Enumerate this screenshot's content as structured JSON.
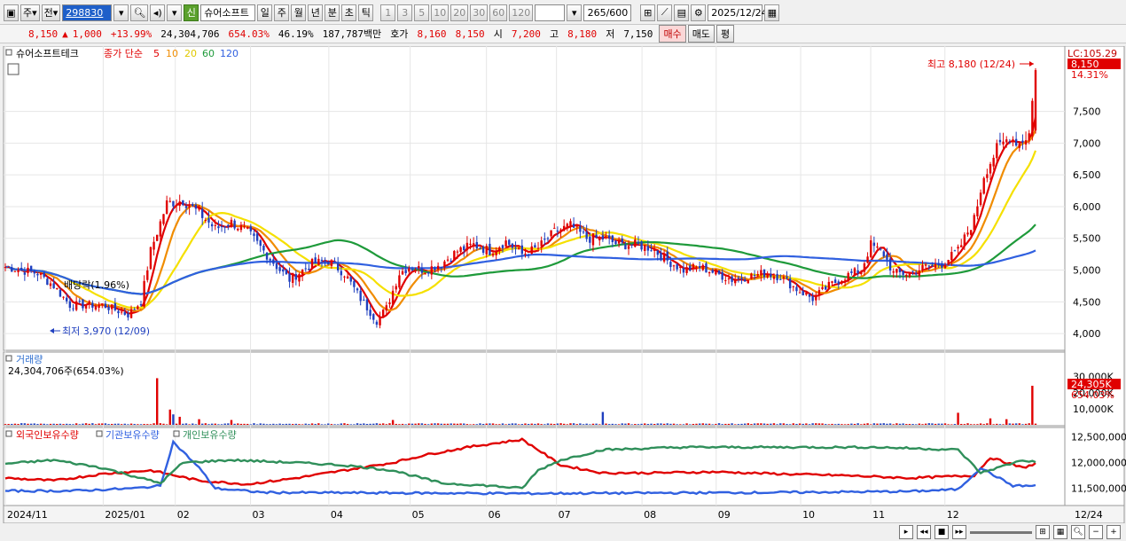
{
  "toolbar": {
    "market_type": "주",
    "compare": "전",
    "code": "298830",
    "new_badge": "신",
    "stock_name": "슈어소프트",
    "periods": [
      "일",
      "주",
      "월",
      "년",
      "분",
      "초",
      "틱"
    ],
    "active_period": "일",
    "intervals": [
      "1",
      "3",
      "5",
      "10",
      "20",
      "30",
      "60",
      "120"
    ],
    "bar_count": "265",
    "bar_total": "/600",
    "date": "2025/12/24"
  },
  "quote": {
    "price": "8,150",
    "up_arrow": "▲",
    "change": "1,000",
    "change_pct": "+13.99%",
    "volume": "24,304,706",
    "volume_ratio": "654.03%",
    "turnover": "46.19%",
    "amount": "187,787백만",
    "bid_label": "호가",
    "bid": "8,160",
    "ask": "8,150",
    "open_label": "시",
    "open": "7,200",
    "high_label": "고",
    "high": "8,180",
    "low_label": "저",
    "low": "7,150",
    "buy_label": "매수",
    "sell_label": "매도",
    "eval_label": "평"
  },
  "legend": {
    "stock": "슈어소프트테크",
    "ma_label": "종가 단순",
    "ma_periods": [
      "5",
      "10",
      "20",
      "60",
      "120"
    ],
    "volume_title": "거래량",
    "volume_value": "24,304,706주(654.03%)",
    "holdings": [
      "외국인보유수량",
      "기관보유수량",
      "개인보유수량"
    ]
  },
  "annotations": {
    "high": "최고 8,180 (12/24)",
    "low": "최저 3,970 (12/09)",
    "dividend": "배당락(1.96%)",
    "lc": "LC:105.29",
    "price_tag": "8,150",
    "price_pct": "14.31%",
    "vol_tag": "24,305K",
    "vol_pct": "654.03%"
  },
  "colors": {
    "up": "#e00000",
    "down": "#1f3fbf",
    "ma5": "#e00000",
    "ma10": "#f08c00",
    "ma20": "#f5e000",
    "ma60": "#1e9a3a",
    "ma120": "#3060e0",
    "foreign": "#e00000",
    "institution": "#3060e0",
    "individual": "#2f8f5a"
  },
  "chart_data": [
    {
      "type": "candlestick",
      "name": "price",
      "y_ticks": [
        4000,
        4500,
        5000,
        5500,
        6000,
        6500,
        7000,
        7500
      ],
      "ylim": [
        3750,
        8500
      ],
      "x_labels": [
        {
          "label": "2024/11",
          "pos": 0.0
        },
        {
          "label": "2025/01",
          "pos": 0.095
        },
        {
          "label": "02",
          "pos": 0.165
        },
        {
          "label": "03",
          "pos": 0.238
        },
        {
          "label": "04",
          "pos": 0.314
        },
        {
          "label": "05",
          "pos": 0.393
        },
        {
          "label": "06",
          "pos": 0.467
        },
        {
          "label": "07",
          "pos": 0.535
        },
        {
          "label": "08",
          "pos": 0.618
        },
        {
          "label": "09",
          "pos": 0.69
        },
        {
          "label": "10",
          "pos": 0.772
        },
        {
          "label": "11",
          "pos": 0.84
        },
        {
          "label": "12",
          "pos": 0.912
        }
      ],
      "last_x_label": "12/24",
      "close_keypoints": [
        [
          0,
          5050
        ],
        [
          10,
          4950
        ],
        [
          15,
          4750
        ],
        [
          20,
          4450
        ],
        [
          30,
          4450
        ],
        [
          38,
          4300
        ],
        [
          42,
          4500
        ],
        [
          45,
          5300
        ],
        [
          50,
          6050
        ],
        [
          55,
          6100
        ],
        [
          60,
          5900
        ],
        [
          65,
          5650
        ],
        [
          70,
          5750
        ],
        [
          75,
          5600
        ],
        [
          80,
          5300
        ],
        [
          85,
          5000
        ],
        [
          88,
          4850
        ],
        [
          95,
          5100
        ],
        [
          100,
          5150
        ],
        [
          105,
          4950
        ],
        [
          110,
          4550
        ],
        [
          115,
          4200
        ],
        [
          118,
          4400
        ],
        [
          122,
          4950
        ],
        [
          125,
          5050
        ],
        [
          130,
          5000
        ],
        [
          135,
          5100
        ],
        [
          140,
          5300
        ],
        [
          145,
          5400
        ],
        [
          150,
          5300
        ],
        [
          155,
          5450
        ],
        [
          160,
          5250
        ],
        [
          165,
          5350
        ],
        [
          170,
          5600
        ],
        [
          175,
          5700
        ],
        [
          180,
          5500
        ],
        [
          185,
          5500
        ],
        [
          190,
          5400
        ],
        [
          195,
          5400
        ],
        [
          200,
          5350
        ],
        [
          205,
          5150
        ],
        [
          210,
          5000
        ],
        [
          215,
          5050
        ],
        [
          220,
          4950
        ],
        [
          225,
          4850
        ],
        [
          230,
          4900
        ],
        [
          235,
          4950
        ],
        [
          240,
          4900
        ],
        [
          245,
          4700
        ],
        [
          250,
          4550
        ],
        [
          255,
          4750
        ],
        [
          260,
          4900
        ],
        [
          265,
          5000
        ],
        [
          268,
          5400
        ],
        [
          272,
          5250
        ],
        [
          275,
          4950
        ],
        [
          280,
          4950
        ],
        [
          285,
          5050
        ],
        [
          290,
          5100
        ],
        [
          295,
          5300
        ],
        [
          300,
          5800
        ],
        [
          303,
          6500
        ],
        [
          307,
          6900
        ],
        [
          311,
          7100
        ],
        [
          314,
          7000
        ],
        [
          317,
          7150
        ],
        [
          319,
          8150
        ]
      ],
      "ma_periods": [
        5,
        10,
        20,
        60,
        120
      ],
      "last": {
        "open": 7200,
        "high": 8180,
        "low": 7150,
        "close": 8150
      }
    },
    {
      "type": "bar",
      "name": "volume",
      "y_ticks": [
        10000,
        20000,
        30000
      ],
      "tick_labels": [
        "10,000K",
        "20,000K",
        "30,000K"
      ],
      "ylim": [
        0,
        32000
      ],
      "spikes": [
        [
          47,
          29000
        ],
        [
          51,
          9500
        ],
        [
          52,
          6500
        ],
        [
          54,
          5000
        ],
        [
          60,
          3500
        ],
        [
          70,
          3000
        ],
        [
          120,
          3000
        ],
        [
          185,
          8000
        ],
        [
          295,
          7500
        ],
        [
          305,
          4000
        ],
        [
          310,
          3500
        ],
        [
          318,
          24305
        ],
        [
          322,
          8500
        ],
        [
          330,
          10000
        ],
        [
          335,
          9500
        ],
        [
          340,
          10000
        ],
        [
          345,
          7500
        ],
        [
          350,
          8000
        ]
      ]
    },
    {
      "type": "line",
      "name": "holdings",
      "y_ticks": [
        11500000,
        12000000,
        12500000
      ],
      "tick_labels": [
        "11,500,000",
        "12,000,000",
        "12,500,000"
      ],
      "ylim": [
        11200000,
        12650000
      ],
      "series": [
        {
          "name": "외국인보유수량",
          "keypoints": [
            [
              0,
              11700000
            ],
            [
              15,
              11650000
            ],
            [
              30,
              11780000
            ],
            [
              45,
              11850000
            ],
            [
              60,
              11650000
            ],
            [
              75,
              11580000
            ],
            [
              90,
              11700000
            ],
            [
              105,
              11850000
            ],
            [
              120,
              12000000
            ],
            [
              130,
              12150000
            ],
            [
              145,
              12320000
            ],
            [
              160,
              12450000
            ],
            [
              165,
              12250000
            ],
            [
              172,
              11950000
            ],
            [
              185,
              11800000
            ],
            [
              200,
              11800000
            ],
            [
              220,
              11820000
            ],
            [
              240,
              11780000
            ],
            [
              260,
              11750000
            ],
            [
              280,
              11700000
            ],
            [
              300,
              11750000
            ],
            [
              305,
              12100000
            ],
            [
              315,
              11900000
            ],
            [
              325,
              12100000
            ],
            [
              335,
              12050000
            ],
            [
              345,
              11900000
            ],
            [
              355,
              11800000
            ]
          ]
        },
        {
          "name": "기관보유수량",
          "keypoints": [
            [
              0,
              11450000
            ],
            [
              20,
              11450000
            ],
            [
              40,
              11500000
            ],
            [
              48,
              11550000
            ],
            [
              52,
              12400000
            ],
            [
              60,
              11900000
            ],
            [
              65,
              11500000
            ],
            [
              80,
              11420000
            ],
            [
              120,
              11410000
            ],
            [
              160,
              11400000
            ],
            [
              200,
              11410000
            ],
            [
              240,
              11420000
            ],
            [
              280,
              11440000
            ],
            [
              295,
              11480000
            ],
            [
              302,
              11900000
            ],
            [
              312,
              11550000
            ],
            [
              330,
              11550000
            ],
            [
              345,
              11650000
            ],
            [
              355,
              11600000
            ]
          ]
        },
        {
          "name": "개인보유수량",
          "keypoints": [
            [
              0,
              11980000
            ],
            [
              15,
              12050000
            ],
            [
              30,
              11900000
            ],
            [
              48,
              11600000
            ],
            [
              55,
              12000000
            ],
            [
              70,
              12050000
            ],
            [
              90,
              12000000
            ],
            [
              105,
              11950000
            ],
            [
              120,
              11850000
            ],
            [
              135,
              11600000
            ],
            [
              150,
              11550000
            ],
            [
              160,
              11500000
            ],
            [
              165,
              11850000
            ],
            [
              172,
              12050000
            ],
            [
              185,
              12250000
            ],
            [
              210,
              12300000
            ],
            [
              240,
              12300000
            ],
            [
              270,
              12300000
            ],
            [
              295,
              12250000
            ],
            [
              302,
              11800000
            ],
            [
              315,
              12050000
            ],
            [
              325,
              11950000
            ],
            [
              335,
              12000000
            ],
            [
              345,
              12150000
            ],
            [
              355,
              12200000
            ]
          ]
        }
      ]
    }
  ]
}
